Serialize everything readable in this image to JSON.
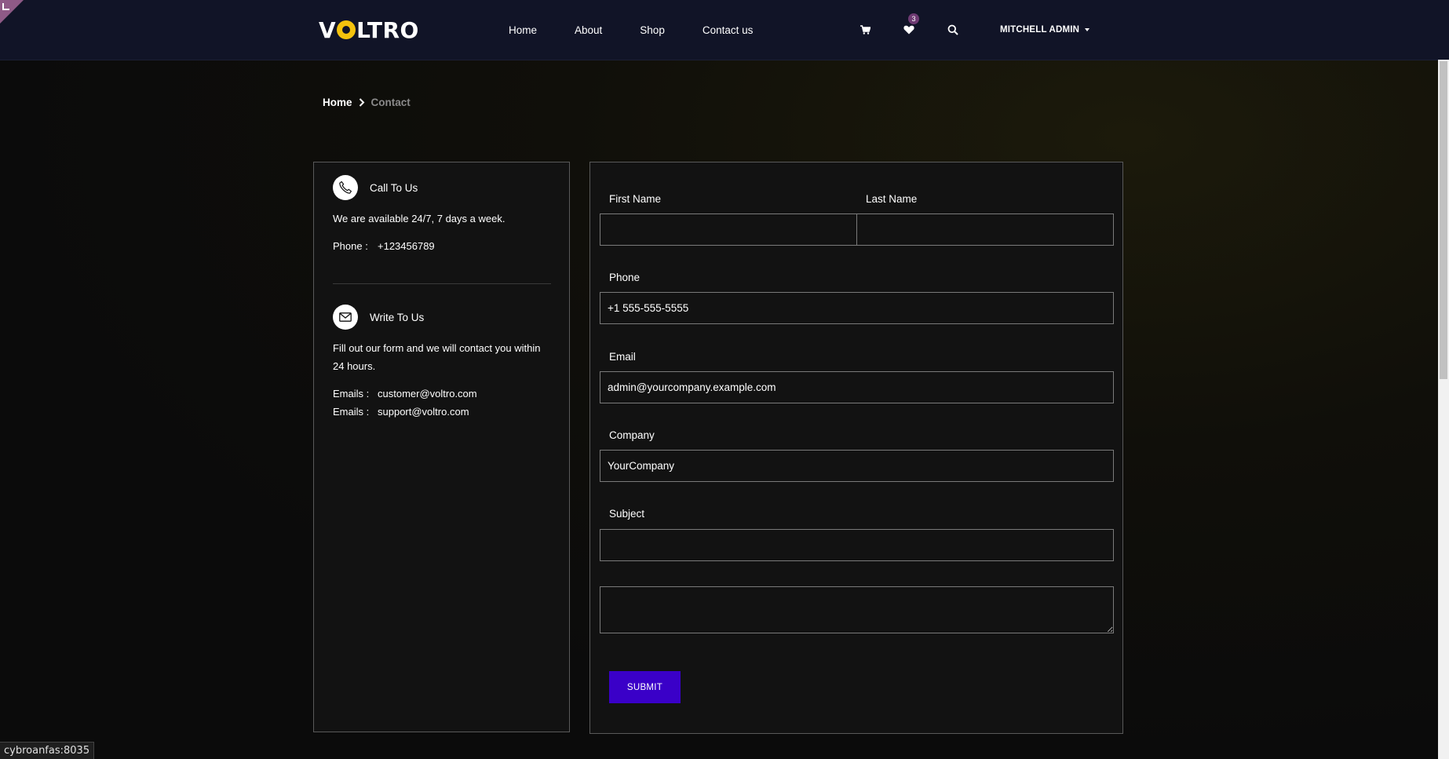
{
  "brand": {
    "logo_before": "V",
    "logo_after": "LTRO",
    "accent_color": "#f4c20d"
  },
  "nav": {
    "links": [
      "Home",
      "About",
      "Shop",
      "Contact us"
    ],
    "cart_icon": "cart-icon",
    "wishlist_icon": "heart-icon",
    "wishlist_count": "3",
    "search_icon": "search-icon",
    "user_name": "MITCHELL ADMIN"
  },
  "breadcrumb": {
    "home": "Home",
    "current": "Contact"
  },
  "contact_info": {
    "call": {
      "title": "Call To Us",
      "text": "We are available 24/7, 7 days a week.",
      "phone_label": "Phone :",
      "phone_value": "+123456789"
    },
    "write": {
      "title": "Write To Us",
      "text": "Fill out our form and we will contact you within 24 hours.",
      "emails_label": "Emails :",
      "emails": [
        "customer@voltro.com",
        "support@voltro.com"
      ]
    }
  },
  "form": {
    "first_name_label": "First Name",
    "first_name_value": "",
    "last_name_label": "Last Name",
    "last_name_value": "",
    "phone_label": "Phone",
    "phone_value": "+1 555-555-5555",
    "email_label": "Email",
    "email_value": "admin@yourcompany.example.com",
    "company_label": "Company",
    "company_value": "YourCompany",
    "subject_label": "Subject",
    "subject_value": "",
    "message_value": "",
    "submit_label": "SUBMIT",
    "submit_color": "#3a00c8"
  },
  "status_bar": {
    "text": "cybroanfas:8035"
  }
}
